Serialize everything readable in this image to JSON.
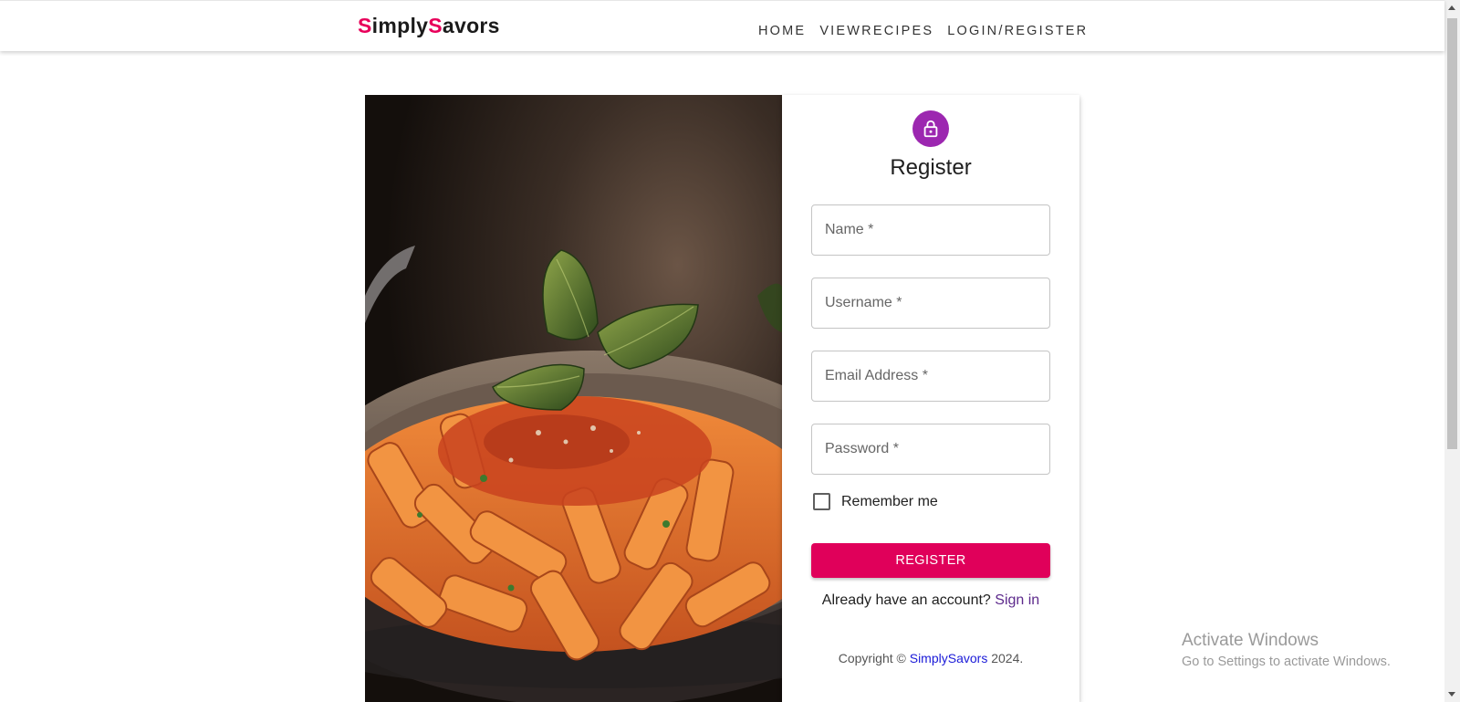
{
  "brand": {
    "first_letter": "S",
    "part1": "imply",
    "second_letter": "S",
    "part2": "avors",
    "accent_color": "#e8005a"
  },
  "nav": {
    "items": [
      {
        "label": "Home"
      },
      {
        "label": "ViewRecipes"
      },
      {
        "label": "Login/Register"
      }
    ]
  },
  "hero": {
    "image": "pasta-dish-photo"
  },
  "form": {
    "icon": "lock-icon",
    "title": "Register",
    "fields": {
      "name": {
        "placeholder": "Name *"
      },
      "username": {
        "placeholder": "Username *"
      },
      "email": {
        "placeholder": "Email Address *"
      },
      "password": {
        "placeholder": "Password *"
      }
    },
    "remember_label": "Remember me",
    "submit_label": "Register",
    "submit_color": "#e0005a",
    "signin_prompt": "Already have an account?",
    "signin_link": "Sign in",
    "copyright_prefix": "Copyright ©",
    "copyright_brand": "SimplySavors",
    "copyright_year": "2024."
  },
  "watermark": {
    "line1": "Activate Windows",
    "line2": "Go to Settings to activate Windows."
  }
}
